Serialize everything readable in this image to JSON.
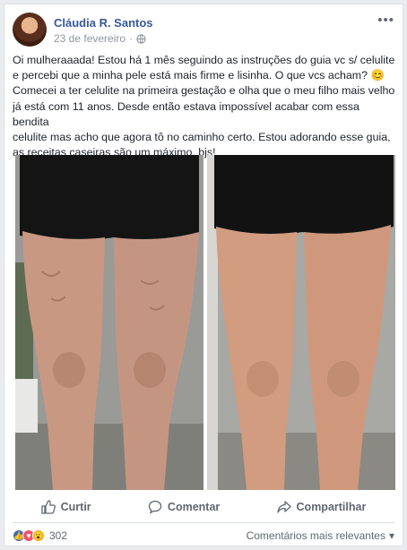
{
  "post": {
    "author": "Cláudia R. Santos",
    "date": "23 de fevereiro",
    "text": "Oi mulheraaada! Estou há 1 mês seguindo as instruções do guia vc s/ celulite\ne percebi que a minha pele está mais firme e lisinha. O que vcs acham? 😊\nComecei a ter celulite na primeira gestação e olha que o meu filho mais velho\njá está com 11 anos. Desde então estava impossível acabar com essa bendita\ncelulite mas acho que agora tô no caminho certo. Estou adorando esse guia,\nas receitas caseiras são um máximo, bjs!"
  },
  "actions": {
    "like": "Curtir",
    "comment": "Comentar",
    "share": "Compartilhar"
  },
  "footer": {
    "reaction_count": "302",
    "sort_label": "Comentários mais relevantes"
  },
  "icons": {
    "more": "more-options-icon",
    "privacy": "globe-icon",
    "like": "thumbs-up-icon",
    "comment": "comment-icon",
    "share": "share-icon"
  },
  "colors": {
    "link": "#365899",
    "like": "#4267b2",
    "love": "#f25268",
    "wow": "#f7b125"
  }
}
